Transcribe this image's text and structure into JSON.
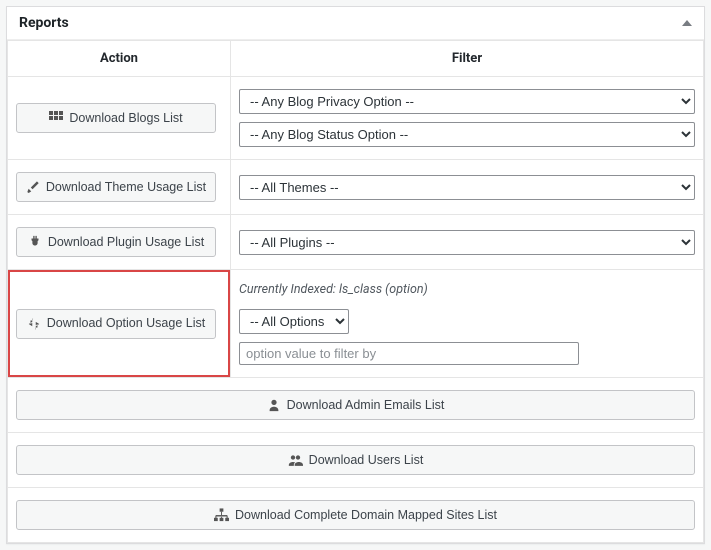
{
  "panel": {
    "title": "Reports"
  },
  "headers": {
    "action": "Action",
    "filter": "Filter"
  },
  "rows": {
    "blogs": {
      "button": "Download Blogs List",
      "privacy_selected": "-- Any Blog Privacy Option --",
      "status_selected": "-- Any Blog Status Option --"
    },
    "themes": {
      "button": "Download Theme Usage List",
      "selected": "-- All Themes --"
    },
    "plugins": {
      "button": "Download Plugin Usage List",
      "selected": "-- All Plugins --"
    },
    "options": {
      "button": "Download Option Usage List",
      "note": "Currently Indexed: ls_class (option)",
      "selected": "-- All Options --",
      "placeholder": "option value to filter by"
    }
  },
  "wide": {
    "admins": "Download Admin Emails List",
    "users": "Download Users List",
    "domains": "Download Complete Domain Mapped Sites List"
  }
}
